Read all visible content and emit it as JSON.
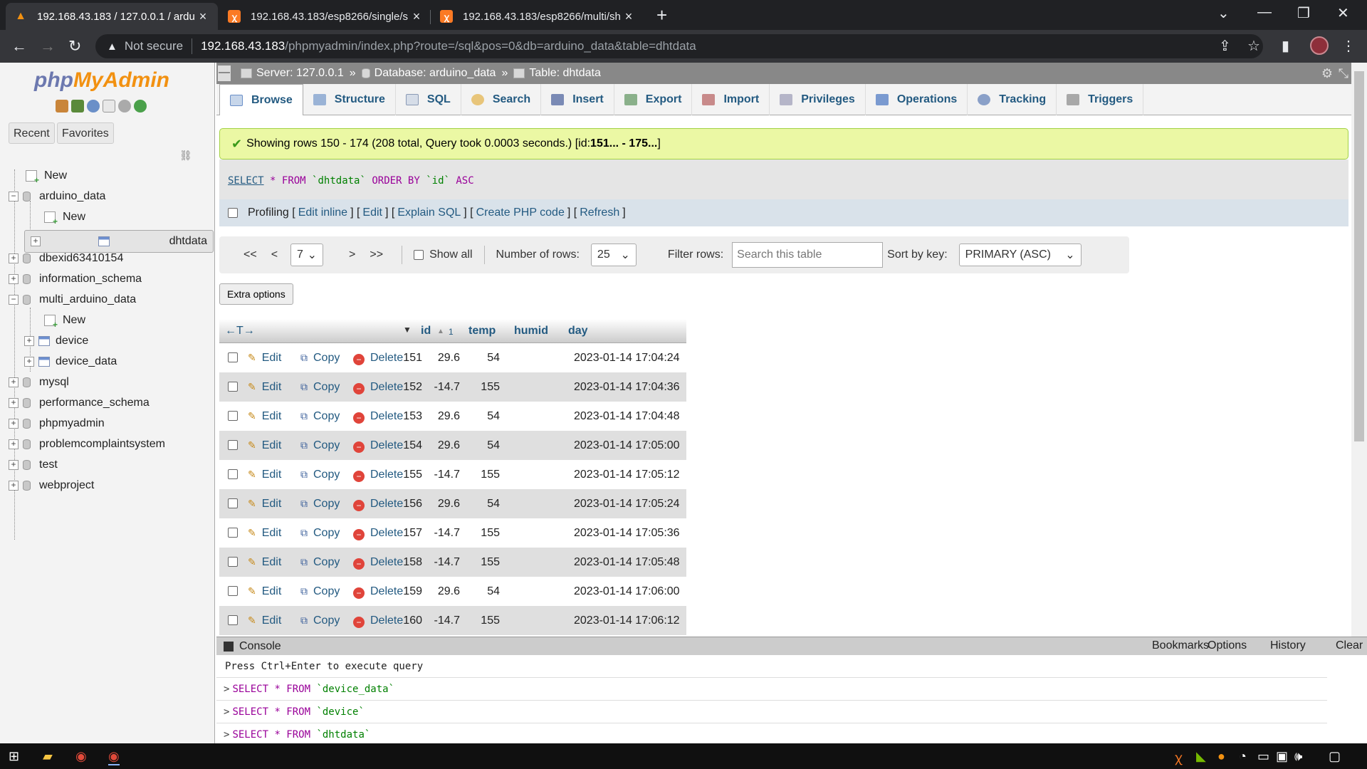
{
  "browser": {
    "tabs": [
      {
        "title": "192.168.43.183 / 127.0.0.1 / ardu",
        "favicon": "phpmyadmin-icon"
      },
      {
        "title": "192.168.43.183/esp8266/single/s",
        "favicon": "xampp-icon"
      },
      {
        "title": "192.168.43.183/esp8266/multi/sh",
        "favicon": "xampp-icon"
      }
    ],
    "security": "Not secure",
    "url_host": "192.168.43.183",
    "url_path": "/phpmyadmin/index.php?route=/sql&pos=0&db=arduino_data&table=dhtdata"
  },
  "sidebar": {
    "logo_php": "php",
    "logo_myadmin": "MyAdmin",
    "tabs": [
      "Recent",
      "Favorites"
    ],
    "tree": [
      {
        "label": "New"
      },
      {
        "label": "arduino_data"
      },
      {
        "label": "New"
      },
      {
        "label": "dhtdata"
      },
      {
        "label": "dbexid63410154"
      },
      {
        "label": "information_schema"
      },
      {
        "label": "multi_arduino_data"
      },
      {
        "label": "New"
      },
      {
        "label": "device"
      },
      {
        "label": "device_data"
      },
      {
        "label": "mysql"
      },
      {
        "label": "performance_schema"
      },
      {
        "label": "phpmyadmin"
      },
      {
        "label": "problemcomplaintsystem"
      },
      {
        "label": "test"
      },
      {
        "label": "webproject"
      }
    ]
  },
  "breadcrumb": {
    "server": "Server: 127.0.0.1",
    "database": "Database: arduino_data",
    "table": "Table: dhtdata",
    "sep": "»"
  },
  "tabs": [
    "Browse",
    "Structure",
    "SQL",
    "Search",
    "Insert",
    "Export",
    "Import",
    "Privileges",
    "Operations",
    "Tracking",
    "Triggers"
  ],
  "message": {
    "text": "Showing rows 150 - 174 (208 total, Query took 0.0003 seconds.) [id: ",
    "range": "151... - 175...",
    "end": "]"
  },
  "sql": {
    "select": "SELECT",
    "star": "*",
    "from": "FROM",
    "table": "`dhtdata`",
    "order": "ORDER BY",
    "col": "`id`",
    "dir": "ASC"
  },
  "profiling": {
    "label": "Profiling",
    "links": [
      "Edit inline",
      "Edit",
      "Explain SQL",
      "Create PHP code",
      "Refresh"
    ]
  },
  "nav": {
    "first": "<<",
    "prev": "<",
    "page": "7",
    "next": ">",
    "last": ">>",
    "show_all": "Show all",
    "num_rows_label": "Number of rows:",
    "num_rows": "25",
    "filter_label": "Filter rows:",
    "filter_placeholder": "Search this table",
    "sort_label": "Sort by key:",
    "sort_value": "PRIMARY (ASC)"
  },
  "extra_options": "Extra options",
  "table": {
    "columns": [
      "id",
      "temp",
      "humid",
      "day"
    ],
    "sort_num": "1",
    "action_labels": {
      "edit": "Edit",
      "copy": "Copy",
      "delete": "Delete"
    },
    "rows": [
      {
        "id": "151",
        "temp": "29.6",
        "humid": "54",
        "day": "2023-01-14 17:04:24"
      },
      {
        "id": "152",
        "temp": "-14.7",
        "humid": "155",
        "day": "2023-01-14 17:04:36"
      },
      {
        "id": "153",
        "temp": "29.6",
        "humid": "54",
        "day": "2023-01-14 17:04:48"
      },
      {
        "id": "154",
        "temp": "29.6",
        "humid": "54",
        "day": "2023-01-14 17:05:00"
      },
      {
        "id": "155",
        "temp": "-14.7",
        "humid": "155",
        "day": "2023-01-14 17:05:12"
      },
      {
        "id": "156",
        "temp": "29.6",
        "humid": "54",
        "day": "2023-01-14 17:05:24"
      },
      {
        "id": "157",
        "temp": "-14.7",
        "humid": "155",
        "day": "2023-01-14 17:05:36"
      },
      {
        "id": "158",
        "temp": "-14.7",
        "humid": "155",
        "day": "2023-01-14 17:05:48"
      },
      {
        "id": "159",
        "temp": "29.6",
        "humid": "54",
        "day": "2023-01-14 17:06:00"
      },
      {
        "id": "160",
        "temp": "-14.7",
        "humid": "155",
        "day": "2023-01-14 17:06:12"
      }
    ]
  },
  "console": {
    "title": "Console",
    "links": [
      "Bookmarks",
      "Options",
      "History",
      "Clear"
    ],
    "hint": "Press Ctrl+Enter to execute query",
    "history": [
      {
        "kw": "SELECT * FROM",
        "tbl": "`device_data`"
      },
      {
        "kw": "SELECT * FROM",
        "tbl": "`device`"
      },
      {
        "kw": "SELECT * FROM",
        "tbl": "`dhtdata`"
      }
    ]
  },
  "colors": {
    "link": "#235a81",
    "success_bg": "#ebf8a4",
    "accent_orange": "#f29111"
  }
}
